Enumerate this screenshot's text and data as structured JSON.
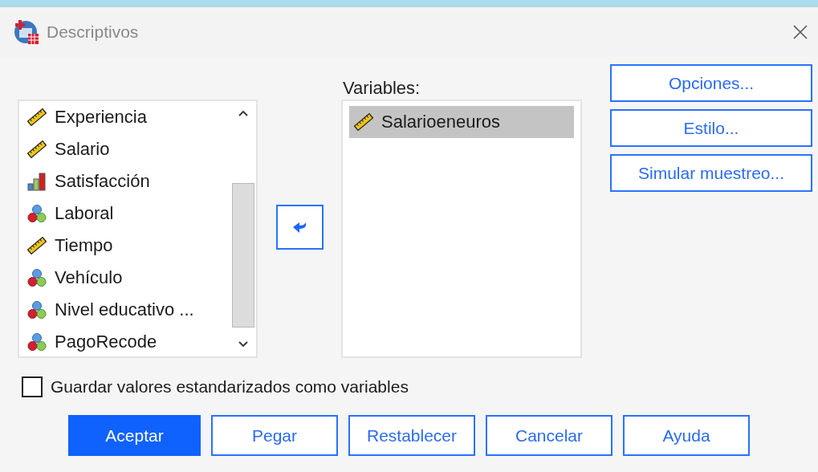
{
  "window": {
    "title": "Descriptivos"
  },
  "source_list": {
    "items": [
      {
        "label": "Experiencia",
        "kind": "scale",
        "selected": false
      },
      {
        "label": "Salario",
        "kind": "scale",
        "selected": false
      },
      {
        "label": "Satisfacción",
        "kind": "ordinal",
        "selected": false
      },
      {
        "label": "Laboral",
        "kind": "nominal",
        "selected": false
      },
      {
        "label": "Tiempo",
        "kind": "scale",
        "selected": false
      },
      {
        "label": "Vehículo",
        "kind": "nominal",
        "selected": false
      },
      {
        "label": "Nivel educativo ...",
        "kind": "nominal",
        "selected": false
      },
      {
        "label": "PagoRecode",
        "kind": "nominal",
        "selected": false
      }
    ]
  },
  "variables": {
    "label": "Variables:",
    "items": [
      {
        "label": "Salarioeneuros",
        "kind": "scale",
        "selected": true
      }
    ]
  },
  "side_buttons": [
    "Opciones...",
    "Estilo...",
    "Simular muestreo..."
  ],
  "save_standardized": {
    "label": "Guardar valores estandarizados como variables",
    "checked": false
  },
  "buttons": [
    {
      "label": "Aceptar",
      "default": true
    },
    {
      "label": "Pegar",
      "default": false
    },
    {
      "label": "Restablecer",
      "default": false
    },
    {
      "label": "Cancelar",
      "default": false
    },
    {
      "label": "Ayuda",
      "default": false
    }
  ]
}
